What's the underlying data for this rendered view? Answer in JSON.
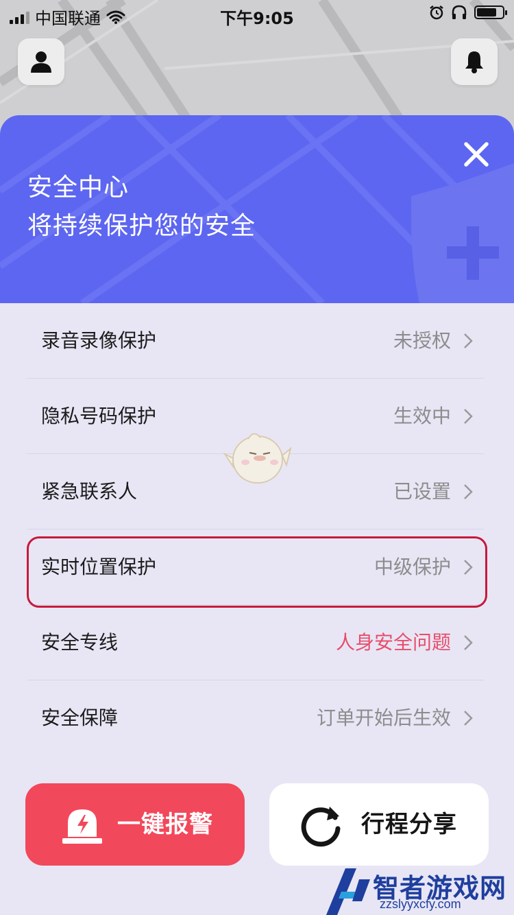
{
  "status_bar": {
    "carrier": "中国联通",
    "time": "下午9:05"
  },
  "header": {
    "title_line1": "安全中心",
    "title_line2": "将持续保护您的安全"
  },
  "rows": [
    {
      "label": "录音录像保护",
      "value": "未授权",
      "accent": false
    },
    {
      "label": "隐私号码保护",
      "value": "生效中",
      "accent": false
    },
    {
      "label": "紧急联系人",
      "value": "已设置",
      "accent": false
    },
    {
      "label": "实时位置保护",
      "value": "中级保护",
      "accent": false
    },
    {
      "label": "安全专线",
      "value": "人身安全问题",
      "accent": true
    },
    {
      "label": "安全保障",
      "value": "订单开始后生效",
      "accent": false
    }
  ],
  "actions": {
    "alarm_label": "一键报警",
    "share_label": "行程分享"
  },
  "watermark": {
    "site_name": "智者游戏网",
    "url": "zzslyyxcfy.com"
  },
  "icons": {
    "profile": "person-icon",
    "notifications": "bell-icon",
    "close": "close-icon",
    "alarm": "alarm-light-icon",
    "share": "refresh-share-icon",
    "row_chevron": "chevron-right-icon"
  },
  "colors": {
    "header_bg": "#5d66f0",
    "alarm_bg": "#f2485b",
    "alert_text": "#e84d6b",
    "highlight_border": "#c8193a"
  }
}
